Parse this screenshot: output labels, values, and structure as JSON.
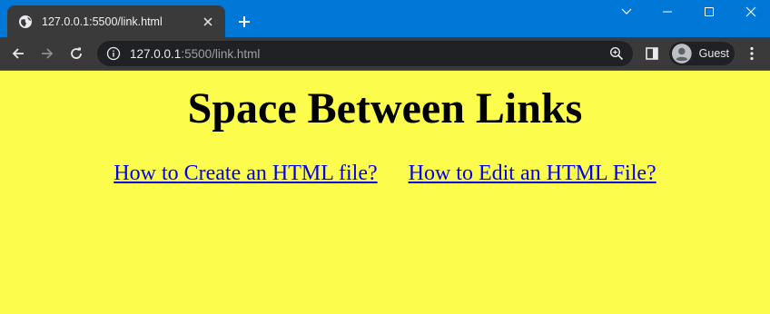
{
  "browser": {
    "tab": {
      "title": "127.0.0.1:5500/link.html",
      "favicon": "globe-icon"
    },
    "address_bar": {
      "host": "127.0.0.1",
      "path": ":5500/link.html"
    },
    "profile": {
      "label": "Guest"
    },
    "colors": {
      "titlebar": "#0078d7",
      "toolbar": "#3a3a3a",
      "omnibox": "#202124"
    }
  },
  "page": {
    "background": "#fcfc4c",
    "heading": "Space Between Links",
    "links": [
      {
        "label": "How to Create an HTML file?"
      },
      {
        "label": "How to Edit an HTML File?"
      }
    ],
    "link_color": "#0000ee"
  }
}
